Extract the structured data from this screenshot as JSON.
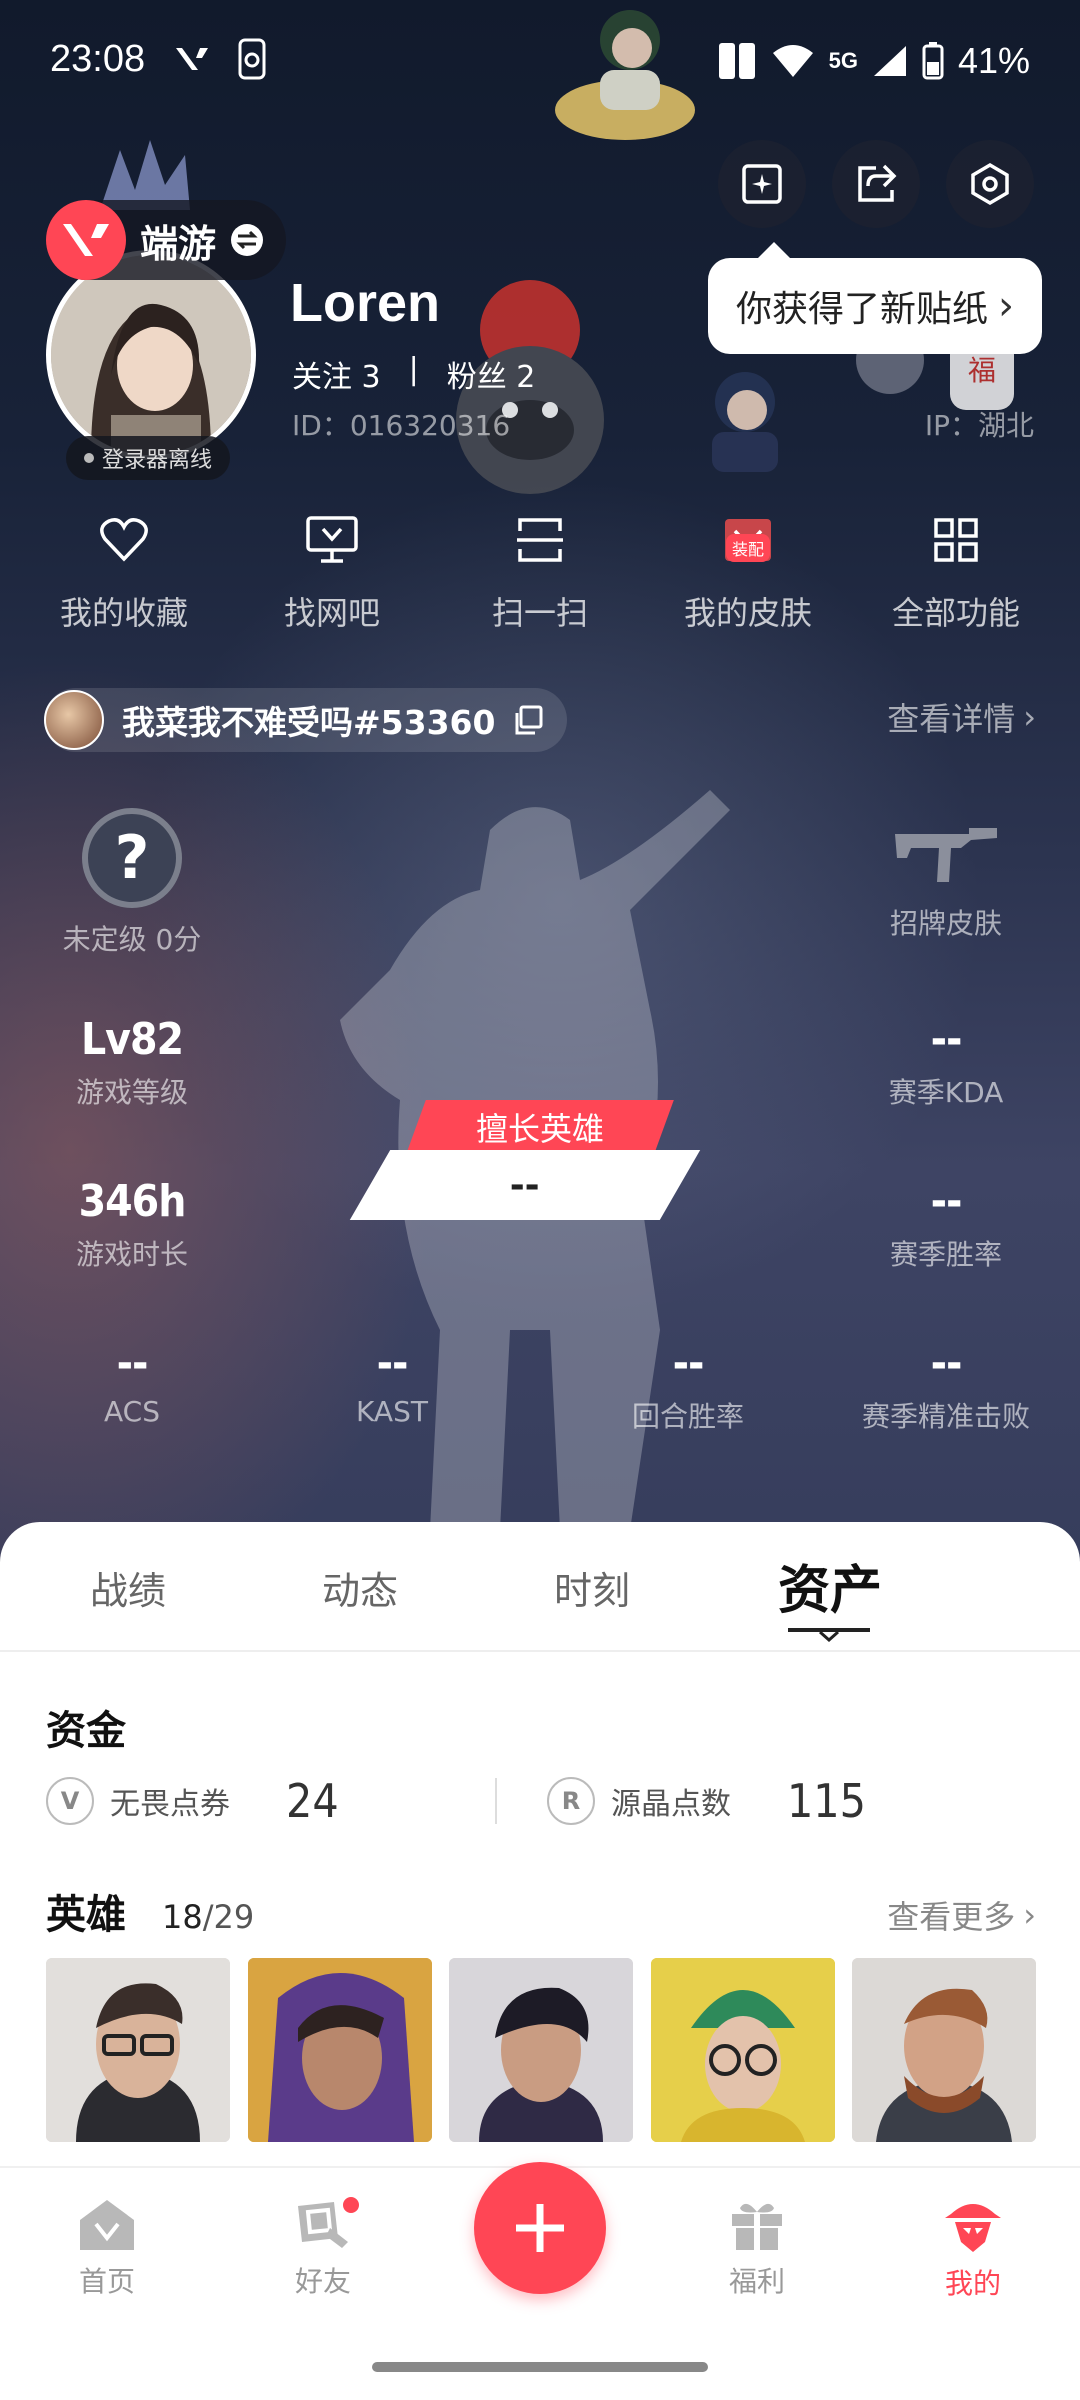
{
  "status_bar": {
    "time": "23:08",
    "network": "5G",
    "battery": "41%"
  },
  "tooltip": {
    "text": "你获得了新贴纸",
    "chevron": "›"
  },
  "app": {
    "name": "端游",
    "switch_icon": "swap-icon"
  },
  "profile": {
    "name": "Loren",
    "follow_label": "关注",
    "follow_count": "3",
    "divider": "|",
    "fans_label": "粉丝",
    "fans_count": "2",
    "id": "ID：016320316",
    "ip": "IP：湖北",
    "status": "登录器离线"
  },
  "quick_functions": [
    {
      "label": "我的收藏",
      "icon": "heart-icon"
    },
    {
      "label": "找网吧",
      "icon": "monitor-icon"
    },
    {
      "label": "扫一扫",
      "icon": "scan-icon"
    },
    {
      "label": "我的皮肤",
      "icon": "skin-icon",
      "tag": "装配"
    },
    {
      "label": "全部功能",
      "icon": "grid-icon"
    }
  ],
  "game_account": {
    "name": "我菜我不难受吗#53360",
    "details": "查看详情"
  },
  "stats": {
    "rank": {
      "label": "未定级 0分"
    },
    "weapon": {
      "label": "招牌皮肤"
    },
    "level": {
      "value": "Lv82",
      "label": "游戏等级"
    },
    "kda": {
      "value": "--",
      "label": "赛季KDA"
    },
    "playtime": {
      "value": "346h",
      "label": "游戏时长"
    },
    "winrate": {
      "value": "--",
      "label": "赛季胜率"
    },
    "best_hero": {
      "tag": "擅长英雄",
      "value": "--"
    },
    "acs": {
      "value": "--",
      "label": "ACS"
    },
    "kast": {
      "value": "--",
      "label": "KAST"
    },
    "round_win": {
      "value": "--",
      "label": "回合胜率"
    },
    "headshot": {
      "value": "--",
      "label": "赛季精准击败"
    }
  },
  "tabs": [
    "战绩",
    "动态",
    "时刻",
    "资产"
  ],
  "active_tab": "资产",
  "funds": {
    "title": "资金",
    "vp_label": "无畏点券",
    "vp_value": "24",
    "rp_label": "源晶点数",
    "rp_value": "115"
  },
  "heroes": {
    "title": "英雄",
    "owned": "18",
    "total": "/29",
    "more": "查看更多"
  },
  "bottom_nav": [
    {
      "label": "首页",
      "icon": "home-icon"
    },
    {
      "label": "好友",
      "icon": "friends-icon"
    },
    {
      "label": "",
      "icon": "plus-icon"
    },
    {
      "label": "福利",
      "icon": "gift-icon"
    },
    {
      "label": "我的",
      "icon": "profile-icon"
    }
  ],
  "colors": {
    "accent": "#ff4655",
    "panel": "#ffffff"
  }
}
